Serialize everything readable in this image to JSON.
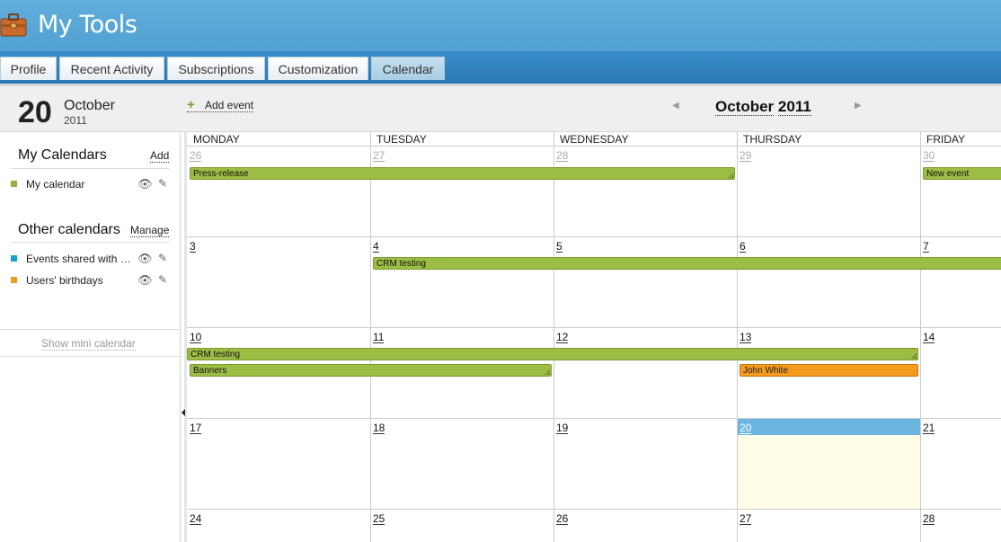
{
  "header": {
    "title": "My Tools",
    "icon": "briefcase-icon"
  },
  "tabs": [
    {
      "label": "Profile"
    },
    {
      "label": "Recent Activity"
    },
    {
      "label": "Subscriptions"
    },
    {
      "label": "Customization"
    },
    {
      "label": "Calendar",
      "active": true
    }
  ],
  "today": {
    "day": "20",
    "month": "October",
    "year": "2011"
  },
  "toolbar": {
    "add_event": "Add event",
    "nav_month": "October",
    "nav_year": "2011"
  },
  "sidebar": {
    "my_calendars_title": "My Calendars",
    "add_label": "Add",
    "my_calendars": [
      {
        "name": "My calendar",
        "color": "#8db33a"
      }
    ],
    "other_calendars_title": "Other calendars",
    "manage_label": "Manage",
    "other_calendars": [
      {
        "name": "Events shared with me",
        "color": "#1ba3c6"
      },
      {
        "name": "Users' birthdays",
        "color": "#f39a1f"
      }
    ],
    "mini_calendar_label": "Show mini calendar"
  },
  "calendar": {
    "weekdays": [
      "MONDAY",
      "TUESDAY",
      "WEDNESDAY",
      "THURSDAY",
      "FRIDAY"
    ],
    "weeks": [
      [
        "26",
        "27",
        "28",
        "29",
        "30"
      ],
      [
        "3",
        "4",
        "5",
        "6",
        "7"
      ],
      [
        "10",
        "11",
        "12",
        "13",
        "14"
      ],
      [
        "17",
        "18",
        "19",
        "20",
        "21"
      ],
      [
        "24",
        "25",
        "26",
        "27",
        "28"
      ]
    ],
    "events": [
      {
        "title": "Press-release",
        "color": "#9dbd45"
      },
      {
        "title": "New event",
        "color": "#9dbd45"
      },
      {
        "title": "CRM testing",
        "color": "#9dbd45"
      },
      {
        "title": "CRM testing",
        "color": "#9dbd45"
      },
      {
        "title": "Banners",
        "color": "#9dbd45"
      },
      {
        "title": "John White",
        "color": "#f39a1f"
      }
    ]
  }
}
